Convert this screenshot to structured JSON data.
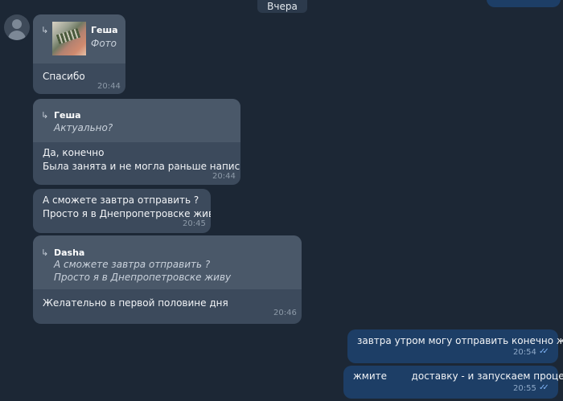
{
  "chat": {
    "date_separator": "Вчера"
  },
  "messages": [
    {
      "reply": {
        "name": "Геша",
        "text": "Фото"
      },
      "lines": [
        "Спасибо"
      ],
      "time": "20:44"
    },
    {
      "reply": {
        "name": "Геша",
        "text": "Актуально?"
      },
      "lines": [
        "Да, конечно",
        "Была занята и не могла раньше написать"
      ],
      "time": "20:44"
    },
    {
      "lines": [
        "А сможете завтра отправить ?",
        "Просто я в Днепропетровске живу"
      ],
      "time": "20:45"
    },
    {
      "reply": {
        "name": "Dasha",
        "lines": [
          "А сможете завтра отправить ?",
          "Просто я в Днепропетровске живу"
        ]
      },
      "lines": [
        "Желательно в первой половине дня"
      ],
      "time": "20:46"
    }
  ],
  "outgoing": [
    {
      "text": "завтра утром могу отправить конечно же.",
      "time": "20:54"
    },
    {
      "text": "жмите        доставку - и запускаем процесс.",
      "time": "20:55"
    }
  ],
  "icons": {
    "reply": "reply-arrow-icon",
    "read": "double-check-icon",
    "avatar": "user-avatar-icon"
  },
  "colors": {
    "background": "#1c2735",
    "incoming_bubble": "#3c4a5c",
    "reply_block": "#4a5869",
    "outgoing_bubble": "#1d3e66",
    "read_ticks": "#7fb3f5"
  }
}
